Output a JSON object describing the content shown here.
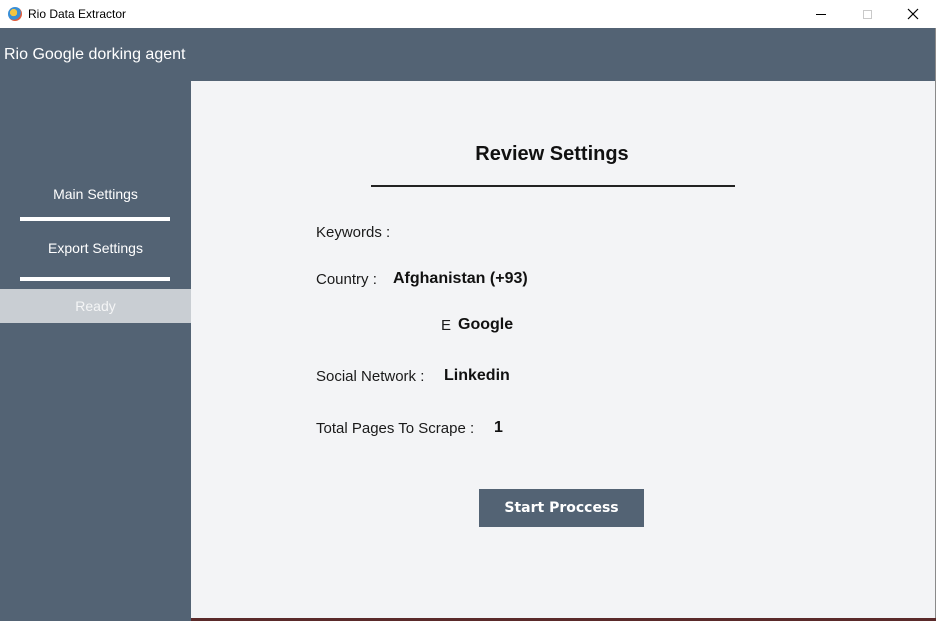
{
  "window": {
    "title": "Rio Data Extractor",
    "icon": "app-logo-icon",
    "controls": [
      "minimize-icon",
      "maximize-icon",
      "close-icon"
    ]
  },
  "header": {
    "app_name": "Rio Google dorking agent"
  },
  "sidebar": {
    "items": [
      {
        "label": "Main Settings"
      },
      {
        "label": "Export Settings"
      },
      {
        "label": "Ready",
        "active": true
      }
    ]
  },
  "review": {
    "title": "Review Settings",
    "keywords_label": "Keywords :",
    "keywords_value": "",
    "country_label": "Country :",
    "country_value": "Afghanistan (+93)",
    "engine_label": "E",
    "engine_value": "Google",
    "social_label": "Social Network :",
    "social_value": "Linkedin",
    "pages_label": "Total Pages To Scrape :",
    "pages_value": "1"
  },
  "actions": {
    "start_label": "Start Proccess"
  },
  "colors": {
    "accent": "#536374",
    "content_bg": "#f3f4f6",
    "active_nav_bg": "#c9ced3"
  }
}
